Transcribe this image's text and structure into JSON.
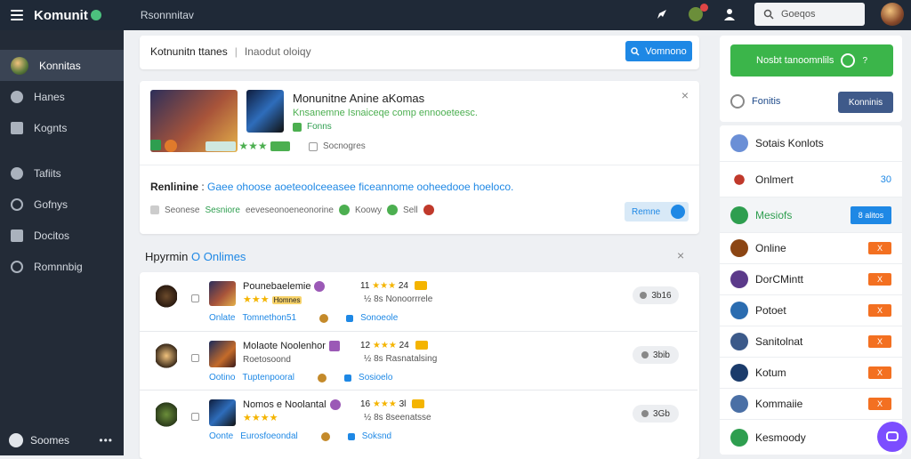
{
  "topbar": {
    "brand": "Komunit",
    "subtitle": "Rsonnnitav",
    "search_placeholder": "Goeqos"
  },
  "sidebar": {
    "items": [
      {
        "label": "Konnitas",
        "icon": "user-avatar-icon",
        "active": true
      },
      {
        "label": "Hanes",
        "icon": "home-icon"
      },
      {
        "label": "Kognts",
        "icon": "building-icon"
      },
      {
        "label": "Tafiits",
        "icon": "person-icon"
      },
      {
        "label": "Gofnys",
        "icon": "circle-icon"
      },
      {
        "label": "Docitos",
        "icon": "group-icon"
      },
      {
        "label": "Romnnbig",
        "icon": "settings-icon"
      }
    ],
    "footer": {
      "label": "Soomes",
      "more": "•••"
    }
  },
  "main": {
    "header": {
      "title": "Kotnunitn ttanes",
      "sep": "|",
      "subtitle": "Inaodut oloiqy",
      "button_label": "Vomnono"
    },
    "feature": {
      "title": "Monunitne Anine aKomas",
      "desc": "Knsanemne Isnaiceqe comp ennooeteesc.",
      "badge_label": "Fonns",
      "count_label": "Socnogres",
      "close": "×",
      "headline": "Renlinine",
      "headline_colon": ":",
      "headline_link": "Gaee ohoose aoeteoolceeasee ficeannome ooheedooe hoeloco.",
      "meta_label": "Seonese",
      "meta_link": "Sesniore",
      "meta_text": "eeveseonoeneonorine",
      "meta_tag1": "Koowy",
      "meta_tag2": "Sell",
      "action_label": "Remne"
    },
    "section": {
      "title": "Hpyrmin",
      "title_link": "O Onlimes",
      "close": "×"
    },
    "rows": [
      {
        "name": "Pounebaelemie",
        "badge": "Homnes",
        "num": "11",
        "num2": "24",
        "stars_text": "½ 8s Nonoorrrele",
        "sub_left": "Onlate",
        "sub_mid": "Tomnethon51",
        "sub_right": "Sonoeole",
        "pill": "3b16"
      },
      {
        "name": "Molaote Noolenhor",
        "badge": "Roetosoond",
        "num": "12",
        "num2": "24",
        "stars_text": "½ 8s Rasnatalsing",
        "sub_left": "Ootino",
        "sub_mid": "Tuptenpooral",
        "sub_right": "Sosioelo",
        "pill": "3bib"
      },
      {
        "name": "Nomos e Noolantal",
        "badge": "",
        "num": "16",
        "num2": "3l",
        "stars_text": "½ 8s 8seenatsse",
        "sub_left": "Oonte",
        "sub_mid": "Eurosfoeondal",
        "sub_right": "Soksnd",
        "pill": "3Gb"
      }
    ]
  },
  "right": {
    "promo_text": "Nosbt tanoomnlils",
    "promo_user": "Fonitis",
    "promo_button": "Konninis",
    "list": [
      {
        "label": "Sotais Konlots",
        "color": "#6b8fd6",
        "action": ""
      },
      {
        "label": "Onlmert",
        "color": "#c0392b",
        "action": "30",
        "action_type": "text"
      },
      {
        "label": "Mesiofs",
        "color": "#2e9e4f",
        "action": "8 alitos",
        "action_type": "blue",
        "highlight": true
      },
      {
        "label": "Online",
        "color": "#8b4513",
        "action": "X",
        "action_type": "orange"
      },
      {
        "label": "DorCMintt",
        "color": "#5b3a8a",
        "action": "X",
        "action_type": "orange"
      },
      {
        "label": "Potoet",
        "color": "#2b6cb0",
        "action": "X",
        "action_type": "orange"
      },
      {
        "label": "Sanitolnat",
        "color": "#3c5a8a",
        "action": "X",
        "action_type": "orange"
      },
      {
        "label": "Kotum",
        "color": "#1b3b6b",
        "action": "X",
        "action_type": "orange"
      },
      {
        "label": "Kommaiie",
        "color": "#4a6fa5",
        "action": "X",
        "action_type": "orange"
      },
      {
        "label": "Kesmoody",
        "color": "#2e9e4f",
        "action": "",
        "action_type": "none"
      }
    ]
  }
}
